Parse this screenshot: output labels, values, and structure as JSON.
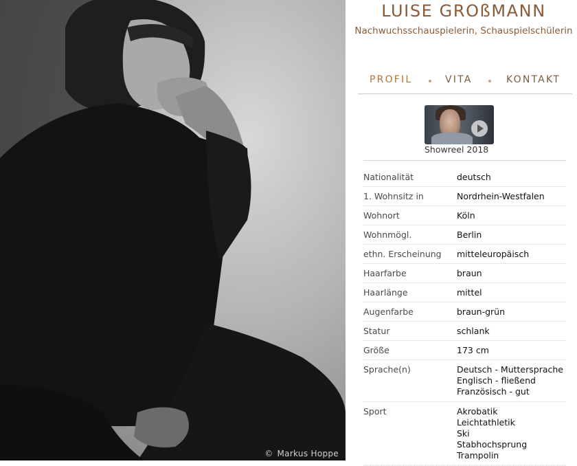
{
  "photo": {
    "credit_symbol": "©",
    "credit_name": "Markus Hoppe"
  },
  "header": {
    "name": "LUISE GROßMANN",
    "subtitle": "Nachwuchsschauspielerin, Schauspielschülerin"
  },
  "nav": {
    "items": [
      {
        "label": "PROFIL"
      },
      {
        "label": "VITA"
      },
      {
        "label": "KONTAKT"
      }
    ]
  },
  "showreel": {
    "caption": "Showreel 2018"
  },
  "profile": [
    {
      "label": "Nationalität",
      "value": [
        "deutsch"
      ]
    },
    {
      "label": "1. Wohnsitz in",
      "value": [
        "Nordrhein-Westfalen"
      ]
    },
    {
      "label": "Wohnort",
      "value": [
        "Köln"
      ]
    },
    {
      "label": "Wohnmögl.",
      "value": [
        "Berlin"
      ]
    },
    {
      "label": "ethn. Erscheinung",
      "value": [
        "mitteleuropäisch"
      ]
    },
    {
      "label": "Haarfarbe",
      "value": [
        "braun"
      ]
    },
    {
      "label": "Haarlänge",
      "value": [
        "mittel"
      ]
    },
    {
      "label": "Augenfarbe",
      "value": [
        "braun-grün"
      ]
    },
    {
      "label": "Statur",
      "value": [
        "schlank"
      ]
    },
    {
      "label": "Größe",
      "value": [
        "173 cm"
      ]
    },
    {
      "label": "Sprache(n)",
      "value": [
        "Deutsch - Muttersprache",
        "Englisch - fließend",
        "Französisch - gut"
      ]
    },
    {
      "label": "Sport",
      "value": [
        "Akrobatik",
        "Leichtathletik",
        "Ski",
        "Stabhochsprung",
        "Trampolin"
      ]
    }
  ],
  "colors": {
    "accent": "#8b5a36",
    "nav_active": "#b8722e",
    "nav_inactive": "#7a5c3e"
  }
}
